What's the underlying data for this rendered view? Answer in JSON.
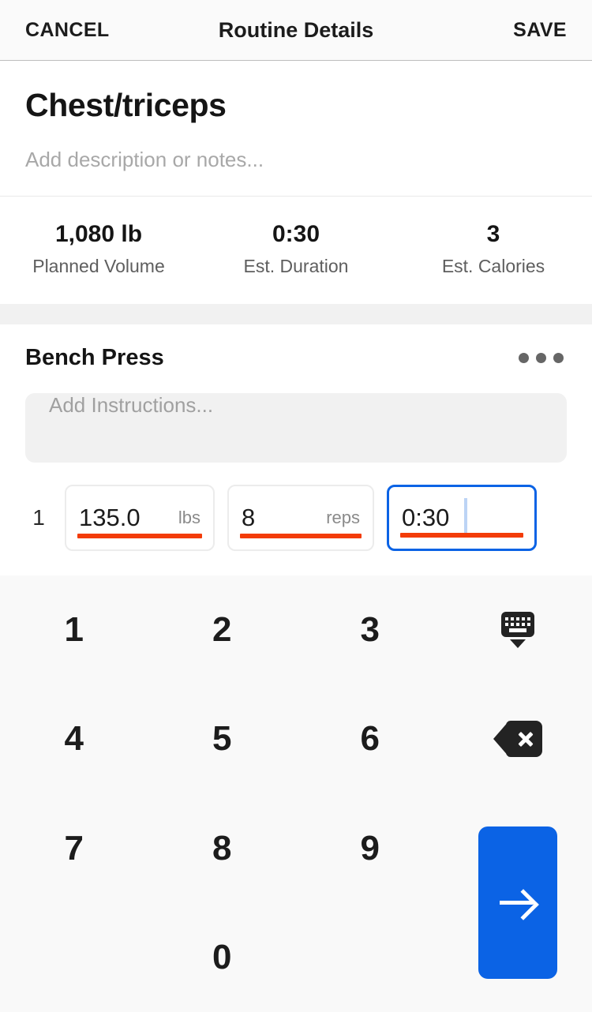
{
  "appbar": {
    "cancel_label": "CANCEL",
    "title": "Routine Details",
    "save_label": "SAVE"
  },
  "routine": {
    "name": "Chest/triceps",
    "description_value": "",
    "description_placeholder": "Add description or notes..."
  },
  "stats": [
    {
      "value": "1,080 lb",
      "label": "Planned Volume"
    },
    {
      "value": "0:30",
      "label": "Est. Duration"
    },
    {
      "value": "3",
      "label": "Est. Calories"
    }
  ],
  "exercise": {
    "name": "Bench Press",
    "menu_icon": "kebab-menu-icon",
    "instructions_value": "",
    "instructions_placeholder": "Add Instructions...",
    "sets": [
      {
        "index": "1",
        "weight_value": "135.0",
        "weight_unit": "lbs",
        "reps_value": "8",
        "reps_unit": "reps",
        "time_value": "0:30",
        "time_unit": "",
        "focused_field": "time"
      }
    ]
  },
  "keyboard": {
    "keys": [
      {
        "type": "digit",
        "label": "1",
        "name": "key-1"
      },
      {
        "type": "digit",
        "label": "2",
        "name": "key-2"
      },
      {
        "type": "digit",
        "label": "3",
        "name": "key-3"
      },
      {
        "type": "icon",
        "label": "",
        "name": "hide-keyboard-icon"
      },
      {
        "type": "digit",
        "label": "4",
        "name": "key-4"
      },
      {
        "type": "digit",
        "label": "5",
        "name": "key-5"
      },
      {
        "type": "digit",
        "label": "6",
        "name": "key-6"
      },
      {
        "type": "icon",
        "label": "",
        "name": "backspace-icon"
      },
      {
        "type": "digit",
        "label": "7",
        "name": "key-7"
      },
      {
        "type": "digit",
        "label": "8",
        "name": "key-8"
      },
      {
        "type": "digit",
        "label": "9",
        "name": "key-9"
      },
      {
        "type": "submit",
        "label": "",
        "name": "submit-arrow-icon"
      },
      {
        "type": "blank",
        "label": "",
        "name": "key-blank-left"
      },
      {
        "type": "digit",
        "label": "0",
        "name": "key-0"
      },
      {
        "type": "blank",
        "label": "",
        "name": "key-blank-right"
      }
    ]
  },
  "colors": {
    "accent_blue": "#0b63e5",
    "underline_red": "#f33c08",
    "band_gray": "#f1f1f1",
    "keyboard_bg": "#f9f9f9"
  }
}
